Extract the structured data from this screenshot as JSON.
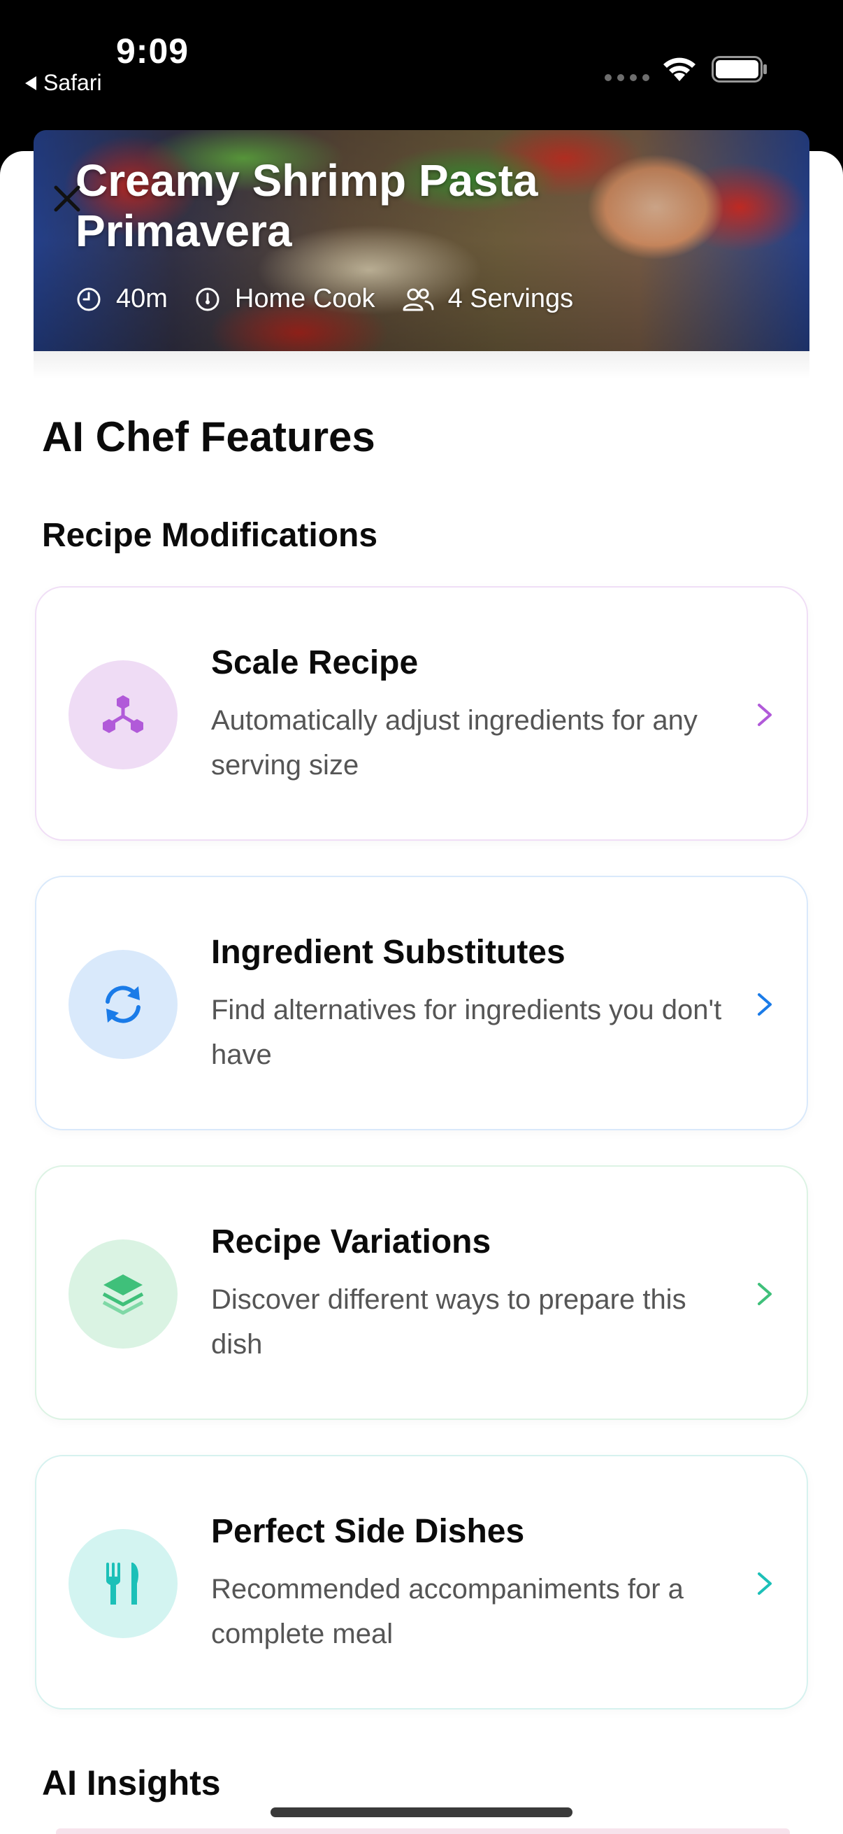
{
  "status_bar": {
    "time": "9:09",
    "back_app": "Safari"
  },
  "recipe": {
    "title": "Creamy Shrimp Pasta Primavera",
    "meta": {
      "time": "40m",
      "difficulty": "Home Cook",
      "servings": "4 Servings"
    }
  },
  "features": {
    "heading": "AI Chef Features",
    "subheading": "Recipe Modifications",
    "cards": [
      {
        "title": "Scale Recipe",
        "description": "Automatically adjust ingredients for any serving size",
        "icon": "scale-network-icon",
        "accent": "#b15ad9",
        "tint": "#efdcf5"
      },
      {
        "title": "Ingredient Substitutes",
        "description": "Find alternatives for ingredients you don't have",
        "icon": "refresh-icon",
        "accent": "#1a7be8",
        "tint": "#d9e9fb"
      },
      {
        "title": "Recipe Variations",
        "description": "Discover different ways to prepare this dish",
        "icon": "layers-icon",
        "accent": "#3fc07a",
        "tint": "#daf3e3"
      },
      {
        "title": "Perfect Side Dishes",
        "description": "Recommended accompaniments for a complete meal",
        "icon": "utensils-icon",
        "accent": "#1cc0b8",
        "tint": "#d3f4f1"
      }
    ]
  },
  "insights": {
    "heading": "AI Insights"
  }
}
